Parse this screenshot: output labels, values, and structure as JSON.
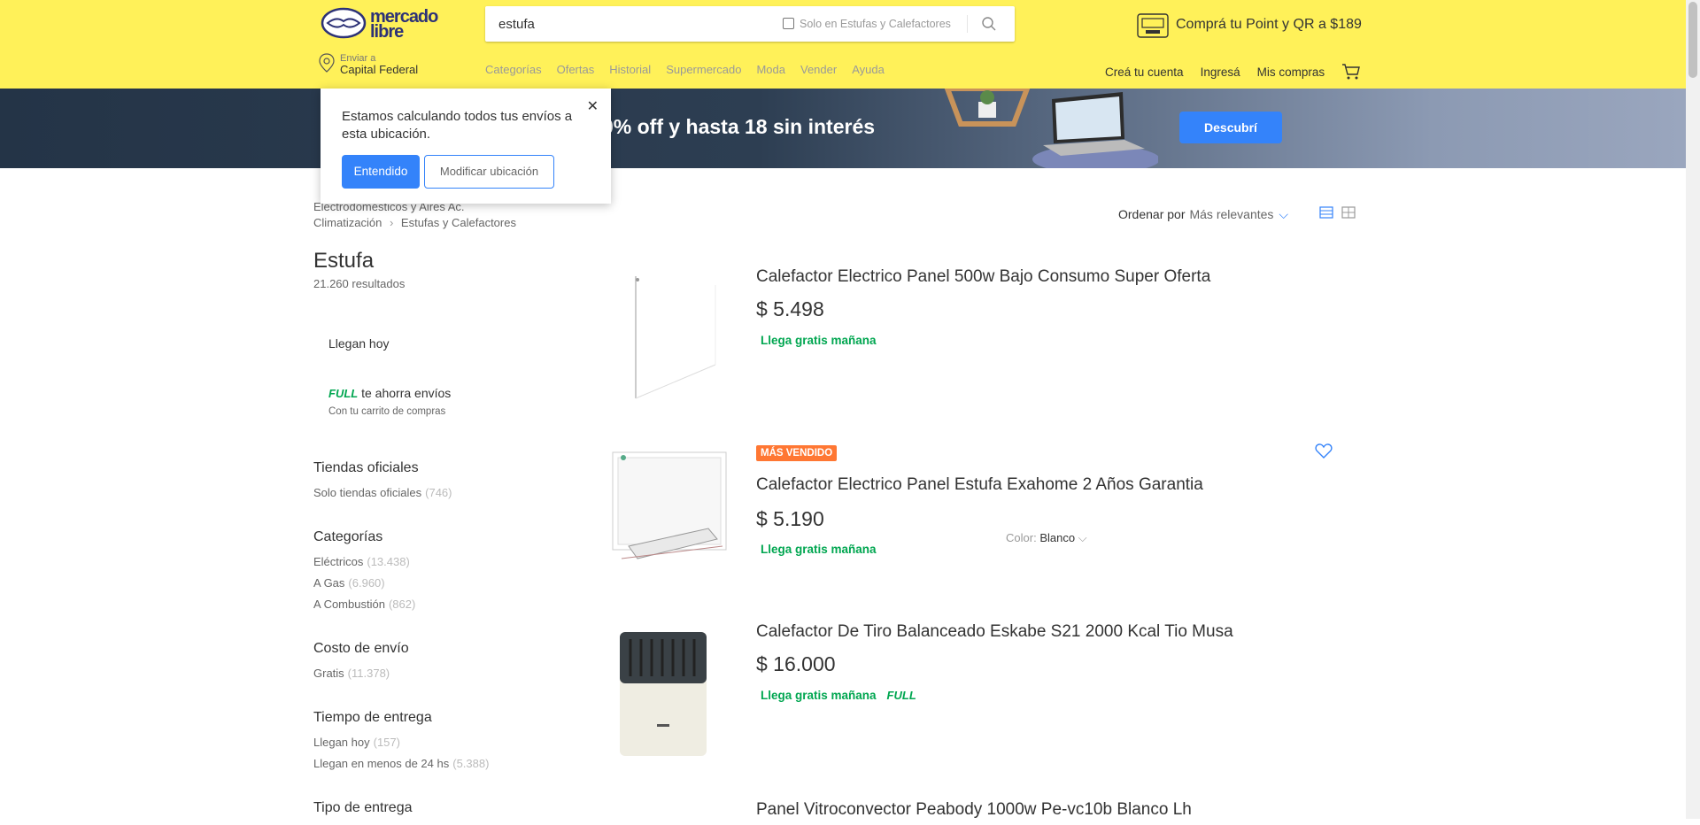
{
  "header": {
    "logo_line1": "mercado",
    "logo_line2": "libre",
    "search_value": "estufa",
    "search_only": "Solo en Estufas y Calefactores",
    "promo": "Comprá tu Point y QR a $189",
    "ship_label": "Enviar a",
    "ship_location": "Capital Federal",
    "nav": [
      "Categorías",
      "Ofertas",
      "Historial",
      "Supermercado",
      "Moda",
      "Vender",
      "Ayuda"
    ],
    "account": [
      "Creá tu cuenta",
      "Ingresá",
      "Mis compras"
    ]
  },
  "banner": {
    "text": "a 40% off y hasta 18 sin interés",
    "button": "Descubrí"
  },
  "popup": {
    "message": "Estamos calculando todos tus envíos a esta ubicación.",
    "confirm": "Entendido",
    "modify": "Modificar ubicación"
  },
  "breadcrumb": {
    "line1": "Electrodomésticos y Aires Ac.",
    "item1": "Climatización",
    "item2": "Estufas y Calefactores"
  },
  "results": {
    "title": "Estufa",
    "count": "21.260 resultados"
  },
  "filter_card": {
    "today": "Llegan hoy",
    "full": "FULL",
    "full_text": "te ahorra envíos",
    "full_sub": "Con tu carrito de compras"
  },
  "filters": [
    {
      "heading": "Tiendas oficiales",
      "options": [
        {
          "label": "Solo tiendas oficiales",
          "count": "(746)"
        }
      ]
    },
    {
      "heading": "Categorías",
      "options": [
        {
          "label": "Eléctricos",
          "count": "(13.438)"
        },
        {
          "label": "A Gas",
          "count": "(6.960)"
        },
        {
          "label": "A Combustión",
          "count": "(862)"
        }
      ]
    },
    {
      "heading": "Costo de envío",
      "options": [
        {
          "label": "Gratis",
          "count": "(11.378)"
        }
      ]
    },
    {
      "heading": "Tiempo de entrega",
      "options": [
        {
          "label": "Llegan hoy",
          "count": "(157)"
        },
        {
          "label": "Llegan en menos de 24 hs",
          "count": "(5.388)"
        }
      ]
    },
    {
      "heading": "Tipo de entrega",
      "options": []
    }
  ],
  "sort": {
    "label": "Ordenar por",
    "value": "Más relevantes"
  },
  "items": [
    {
      "title": "Calefactor Electrico Panel 500w Bajo Consumo Super Oferta",
      "price": "$ 5.498",
      "shipping": "Llega gratis mañana"
    },
    {
      "badge": "MÁS VENDIDO",
      "title": "Calefactor Electrico Panel Estufa Exahome 2 Años Garantia",
      "price": "$ 5.190",
      "shipping": "Llega gratis mañana",
      "color_label": "Color:",
      "color_value": "Blanco"
    },
    {
      "title": "Calefactor De Tiro Balanceado Eskabe S21 2000 Kcal Tio Musa",
      "price": "$ 16.000",
      "shipping": "Llega gratis mañana",
      "full": "FULL"
    },
    {
      "title": "Panel Vitroconvector Peabody 1000w Pe-vc10b Blanco Lh"
    }
  ],
  "colors": {
    "header": "#fff159",
    "accent": "#3483fa",
    "green": "#00a650",
    "badge": "#ff7733"
  }
}
